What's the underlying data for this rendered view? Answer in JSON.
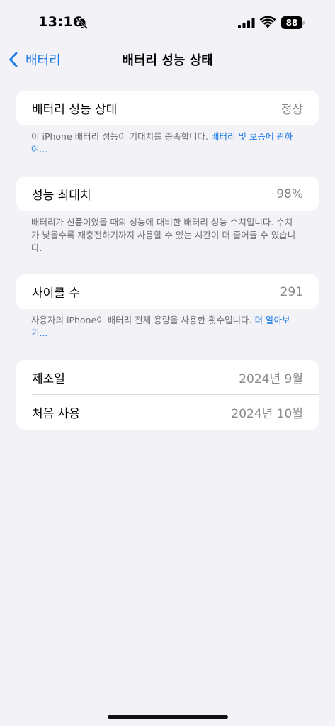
{
  "status_bar": {
    "time": "13:16",
    "battery_level": "88",
    "icons": [
      "bell-slash-icon",
      "signal-icon",
      "wifi-icon",
      "battery-icon"
    ]
  },
  "nav": {
    "back_label": "배터리",
    "title": "배터리 성능 상태"
  },
  "health": {
    "label": "배터리 성능 상태",
    "value": "정상",
    "footer_text": "이 iPhone 배터리 성능이 기대치를 충족합니다. ",
    "footer_link": "배터리 및 보증에 관하여..."
  },
  "max_capacity": {
    "label": "성능 최대치",
    "value": "98%",
    "footer_text": "배터리가 신품이었을 때의 성능에 대비한 배터리 성능 수치입니다. 수치가 낮을수록 재충전하기까지 사용할 수 있는 시간이 더 줄어들 수 있습니다."
  },
  "cycle_count": {
    "label": "사이클 수",
    "value": "291",
    "footer_text": "사용자의 iPhone이 배터리 전체 용량을 사용한 횟수입니다. ",
    "footer_link": "더 알아보기..."
  },
  "dates": {
    "manufacture_label": "제조일",
    "manufacture_value": "2024년 9월",
    "first_use_label": "처음 사용",
    "first_use_value": "2024년 10월"
  },
  "colors": {
    "accent": "#1a7ae6",
    "background": "#f2f2f7",
    "secondary_text": "#8a8a8e"
  }
}
